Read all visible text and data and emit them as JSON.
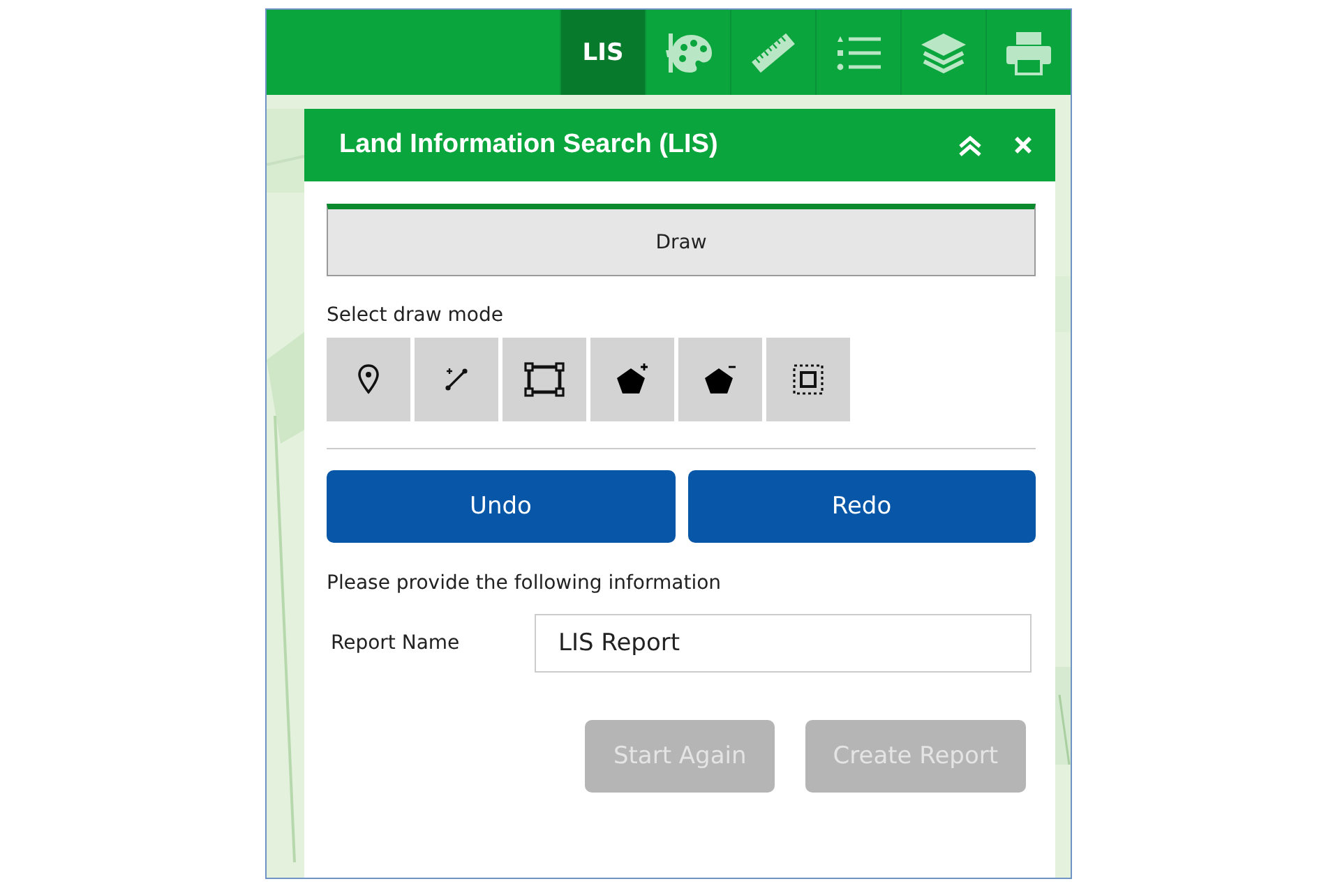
{
  "toolbar": {
    "items": [
      {
        "kind": "text",
        "label": "LIS",
        "selected": true
      },
      {
        "kind": "palette",
        "selected": false
      },
      {
        "kind": "ruler",
        "selected": false
      },
      {
        "kind": "list",
        "selected": false
      },
      {
        "kind": "layers",
        "selected": false
      },
      {
        "kind": "print",
        "selected": false
      }
    ]
  },
  "panel": {
    "title": "Land Information Search (LIS)",
    "tab": {
      "label": "Draw",
      "selected": true
    },
    "draw_mode_label": "Select draw mode",
    "draw_modes": [
      {
        "kind": "point"
      },
      {
        "kind": "line"
      },
      {
        "kind": "rectangle"
      },
      {
        "kind": "addpolygon"
      },
      {
        "kind": "removepolygon"
      },
      {
        "kind": "extent"
      }
    ],
    "edit_buttons": [
      {
        "label": "Undo",
        "disabled": false
      },
      {
        "label": "Redo",
        "disabled": false
      }
    ],
    "instruction": "Please provide the following information",
    "report_field": {
      "label": "Report Name",
      "value": "LIS Report"
    },
    "action_buttons": [
      {
        "label": "Start Again",
        "disabled": true
      },
      {
        "label": "Create Report",
        "disabled": true
      }
    ]
  }
}
